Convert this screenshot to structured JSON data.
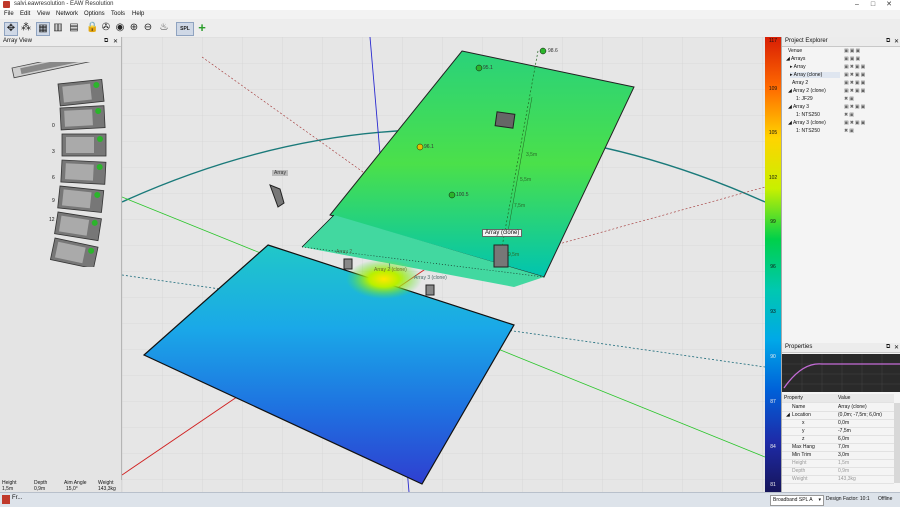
{
  "window": {
    "title": "salvi.eawresolution - EAW Resolution"
  },
  "menu": [
    "File",
    "Edit",
    "View",
    "Network",
    "Options",
    "Tools",
    "Help"
  ],
  "toolbar": {
    "spl_label": "SPL"
  },
  "array_view": {
    "title": "Array View",
    "angles": [
      "0",
      "3",
      "6",
      "9",
      "12"
    ],
    "info_labels": [
      "Height",
      "Depth",
      "Aim Angle",
      "Weight"
    ],
    "info_values": [
      "1,5m",
      "0,9m",
      "15,0°",
      "143,3kg"
    ]
  },
  "viewport": {
    "markers": [
      "98.6",
      "95.1",
      "96.1",
      "100.5"
    ],
    "array_labels": [
      "Array",
      "Array (clone)",
      "Array 2",
      "Array 2 (clone)",
      "Array 3 (clone)"
    ],
    "distance_labels": [
      "3,5m",
      "5,5m",
      "7,5m",
      "9,5m"
    ]
  },
  "colorbar": {
    "ticks": [
      "117",
      "109",
      "105",
      "102",
      "99",
      "96",
      "93",
      "90",
      "87",
      "84",
      "81"
    ],
    "colors": [
      "#d81e05",
      "#ff6a00",
      "#ffd400",
      "#c8f000",
      "#00d04a",
      "#00c8b0",
      "#00a8e8",
      "#0060d8",
      "#1e2ba8",
      "#16155a"
    ]
  },
  "project_explorer": {
    "title": "Project Explorer",
    "items": [
      "Venue",
      "Arrays",
      "Array",
      "Array (clone)",
      "Array 2",
      "Array 2 (clone)",
      "1: JF29",
      "Array 3",
      "1: NTS250",
      "Array 3 (clone)",
      "1: NTS250"
    ]
  },
  "properties": {
    "title": "Properties",
    "col_property": "Property",
    "col_value": "Value",
    "rows": [
      {
        "k": "Name",
        "v": "Array (clone)"
      },
      {
        "k": "Location",
        "v": "(0,0m; -7,5m; 6,0m)"
      },
      {
        "k": "x",
        "v": "0,0m"
      },
      {
        "k": "y",
        "v": "-7,5m"
      },
      {
        "k": "z",
        "v": "6,0m"
      },
      {
        "k": "Max Hang",
        "v": "7,0m"
      },
      {
        "k": "Min Trim",
        "v": "3,0m"
      },
      {
        "k": "Height",
        "v": "1,5m"
      },
      {
        "k": "Depth",
        "v": "0,9m"
      },
      {
        "k": "Weight",
        "v": "143,3kg"
      }
    ]
  },
  "status": {
    "spl_mode": "Broadband SPL A",
    "design_factor": "Design Factor: 10:1",
    "connection": "Offline"
  },
  "taskbar": {
    "item": "Fr..."
  }
}
